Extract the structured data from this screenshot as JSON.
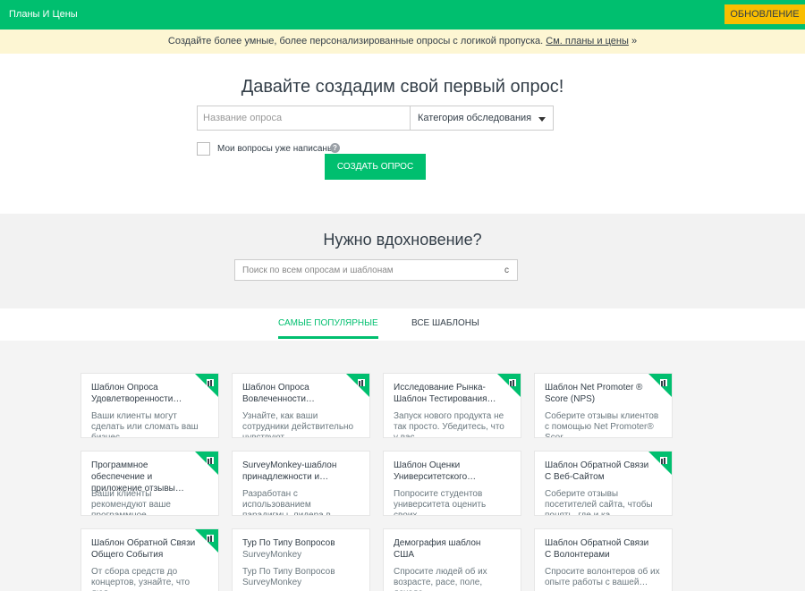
{
  "topbar": {
    "plans_label": "Планы И Цены",
    "upgrade_label": "ОБНОВЛЕНИЕ"
  },
  "promo": {
    "text": "Создайте более умные, более персонализированные опросы с логикой пропуска.",
    "link_text": "См. планы и цены",
    "arrow": "»"
  },
  "create": {
    "heading": "Давайте создадим свой первый опрос!",
    "name_placeholder": "Название опроса",
    "category_label": "Категория обследования",
    "checkbox_label": "Мои вопросы уже написаны.",
    "help_glyph": "?",
    "button_label": "СОЗДАТЬ ОПРОС"
  },
  "inspire": {
    "heading": "Нужно вдохновение?",
    "search_placeholder": "Поиск по всем опросам и шаблонам",
    "search_glyph": "с"
  },
  "tabs": {
    "popular": "САМЫЕ ПОПУЛЯРНЫЕ",
    "all": "ВСЕ ШАБЛОНЫ"
  },
  "colors": {
    "brand_green": "#00bf6f",
    "upgrade_yellow": "#f9be00",
    "promo_bg": "#fdf6d3"
  },
  "cards": [
    {
      "title": "Шаблон Опроса Удовлетворенности…",
      "desc": "Ваши клиенты могут сделать или сломать ваш бизнес…",
      "badge": true
    },
    {
      "title": "Шаблон Опроса Вовлеченности…",
      "desc": "Узнайте, как ваши сотрудники действительно чувствуют…",
      "badge": true
    },
    {
      "title": "Исследование Рынка-Шаблон Тестирования…",
      "desc": "Запуск нового продукта не так просто. Убедитесь, что у вас…",
      "badge": true
    },
    {
      "title": "Шаблон Net Promoter ® Score (NPS)",
      "desc": "Соберите отзывы клиентов с помощью Net Promoter® Scor…",
      "badge": true
    },
    {
      "title": "Программное обеспечение и приложение отзывы…",
      "desc": "Ваши клиенты рекомендуют ваше программное…",
      "badge": true
    },
    {
      "title": "SurveyMonkey-шаблон принадлежности и…",
      "desc": "Разработан с использованием парадигмы, лидера в…",
      "badge": false
    },
    {
      "title": "Шаблон Оценки Университетского…",
      "desc": "Попросите студентов университета оценить своих…",
      "badge": false
    },
    {
      "title": "Шаблон Обратной Связи С Веб-Сайтом",
      "desc": "Соберите отзывы посетителей сайта, чтобы понять, где и ка…",
      "badge": true
    },
    {
      "title": "Шаблон Обратной Связи Общего События",
      "desc": "От сбора средств до концертов, узнайте, что люд…",
      "badge": true
    },
    {
      "title": "Тур По Типу Вопросов",
      "sub": "SurveyMonkey",
      "desc": "Тур По Типу Вопросов",
      "desc_sub": "SurveyMonkey",
      "badge": false
    },
    {
      "title": "Демография шаблон США",
      "desc": "Спросите людей об их возрасте, расе, поле, дохода…",
      "badge": false
    },
    {
      "title": "Шаблон Обратной Связи С Волонтерами",
      "desc": "Спросите волонтеров об их опыте работы с вашей…",
      "badge": false
    }
  ]
}
